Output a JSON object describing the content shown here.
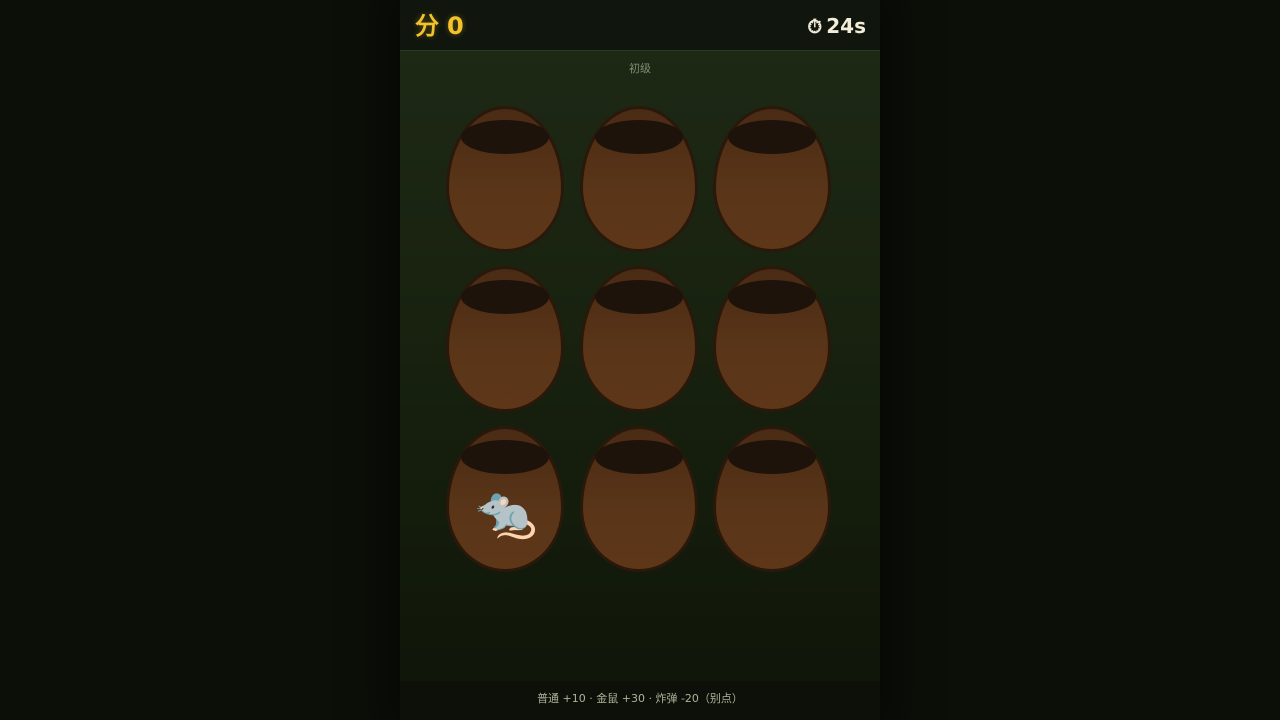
{
  "header": {
    "score_label": "分",
    "score_value": "0",
    "timer_icon": "stopwatch-icon",
    "timer_value": "24s"
  },
  "level": "初级",
  "grid": {
    "rows": 3,
    "cols": 3,
    "holes": [
      {
        "id": 1,
        "occupant": ""
      },
      {
        "id": 2,
        "occupant": ""
      },
      {
        "id": 3,
        "occupant": ""
      },
      {
        "id": 4,
        "occupant": ""
      },
      {
        "id": 5,
        "occupant": ""
      },
      {
        "id": 6,
        "occupant": ""
      },
      {
        "id": 7,
        "occupant": "mouse",
        "glyph": "🐀"
      },
      {
        "id": 8,
        "occupant": ""
      },
      {
        "id": 9,
        "occupant": ""
      }
    ]
  },
  "footer": {
    "rules": "普通 +10 · 金鼠 +30 · 炸弹 -20（别点）"
  },
  "colors": {
    "score": "#f4c22a",
    "hole": "#5a3518",
    "hole_mouth": "#1e130a",
    "background": "#1e2916"
  }
}
